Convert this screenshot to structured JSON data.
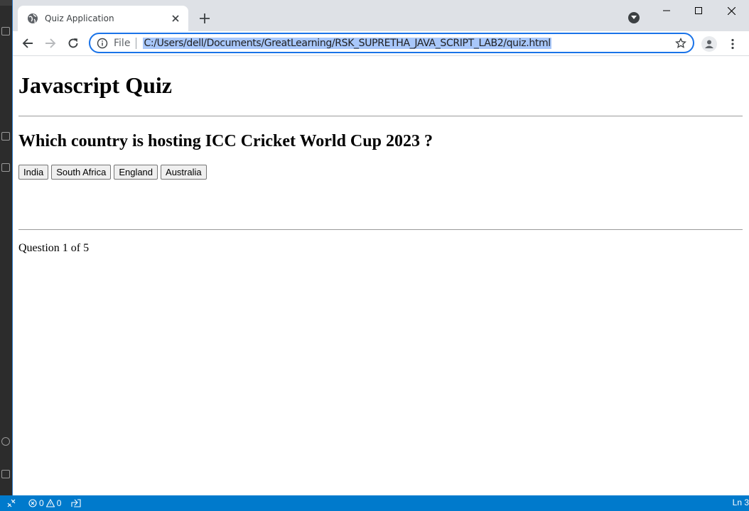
{
  "browser": {
    "tab": {
      "title": "Quiz Application"
    },
    "address_bar": {
      "scheme_label": "File",
      "url": "C:/Users/dell/Documents/GreatLearning/RSK_SUPRETHA_JAVA_SCRIPT_LAB2/quiz.html"
    },
    "accent_color": "#1a73e8"
  },
  "page": {
    "title": "Javascript Quiz",
    "question": "Which country is hosting ICC Cricket World Cup 2023 ?",
    "choices": [
      "India",
      "South Africa",
      "England",
      "Australia"
    ],
    "progress": "Question 1 of 5"
  },
  "statusbar": {
    "errors": "0",
    "warnings": "0",
    "position": "Ln 3",
    "background_color": "#007acc"
  }
}
